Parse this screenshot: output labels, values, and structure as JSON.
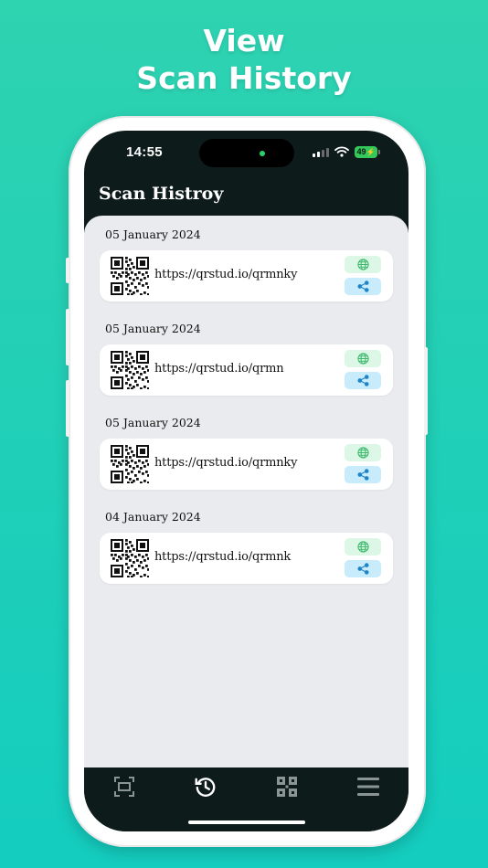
{
  "headline": {
    "line1": "View",
    "line2": "Scan History"
  },
  "status_bar": {
    "time": "14:55",
    "battery": "49"
  },
  "header": {
    "title": "Scan Histroy"
  },
  "history": [
    {
      "date": "05 January 2024",
      "url": "https://qrstud.io/qrmnky"
    },
    {
      "date": "05 January 2024",
      "url": "https://qrstud.io/qrmn"
    },
    {
      "date": "05 January 2024",
      "url": "https://qrstud.io/qrmnky"
    },
    {
      "date": "04 January 2024",
      "url": "https://qrstud.io/qrmnk"
    }
  ],
  "icons": {
    "item": [
      "qr-code-icon",
      "globe-icon",
      "share-icon"
    ],
    "nav": [
      "scan-icon",
      "history-icon",
      "qr-grid-icon",
      "menu-icon"
    ]
  },
  "colors": {
    "background": "#1fcfb8",
    "dark": "#0d1b1a",
    "content": "#e9ebee",
    "web_button": "#dcf7e6",
    "share_button": "#c8ecfb",
    "web_icon": "#3cb96b",
    "share_icon": "#1f86c8",
    "nav_active": "#ffffff",
    "nav_inactive": "#8a9594"
  }
}
